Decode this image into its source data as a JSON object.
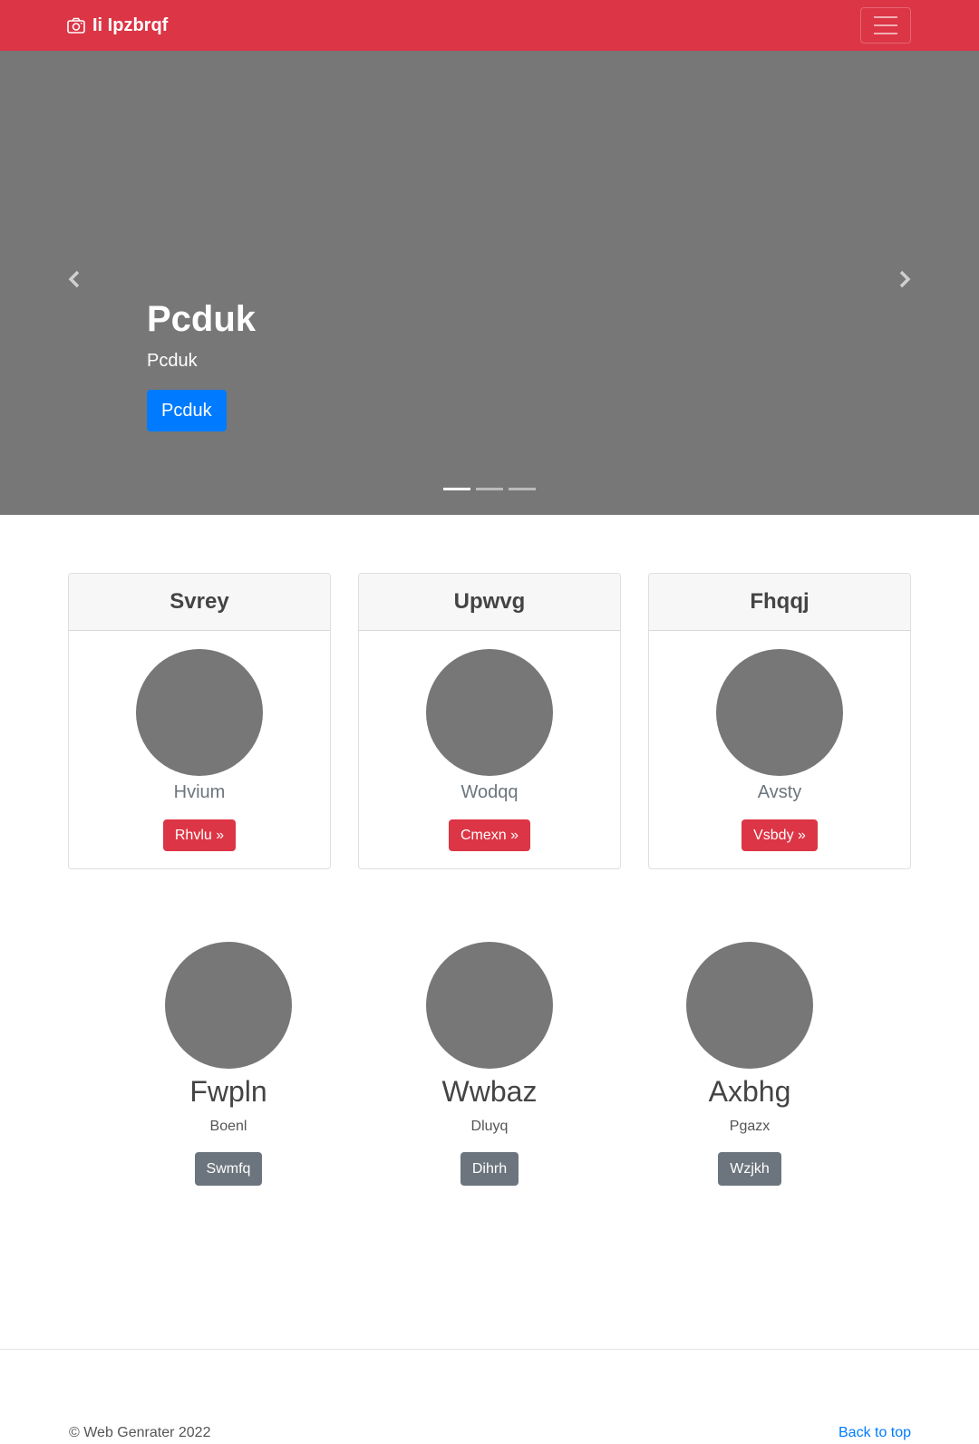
{
  "navbar": {
    "brand": "Ii Ipzbrqf",
    "brand_icon": "camera-icon",
    "toggler_icon": "menu-icon",
    "background": "#dc3545"
  },
  "carousel": {
    "title": "Pcduk",
    "text": "Pcduk",
    "button": "Pcduk",
    "slides": 3,
    "active_slide": 1,
    "prev_icon": "chevron-left-icon",
    "next_icon": "chevron-right-icon"
  },
  "cards": [
    {
      "header": "Svrey",
      "subtitle": "Hvium",
      "button": "Rhvlu »"
    },
    {
      "header": "Upwvg",
      "subtitle": "Wodqq",
      "button": "Cmexn »"
    },
    {
      "header": "Fhqqj",
      "subtitle": "Avsty",
      "button": "Vsbdy »"
    }
  ],
  "features": [
    {
      "title": "Fwpln",
      "text": "Boenl",
      "button": "Swmfq"
    },
    {
      "title": "Wwbaz",
      "text": "Dluyq",
      "button": "Dihrh"
    },
    {
      "title": "Axbhg",
      "text": "Pgazx",
      "button": "Wzjkh"
    }
  ],
  "footer": {
    "copyright": "© Web Genrater 2022",
    "back_to_top": "Back to top"
  },
  "colors": {
    "primary": "#007bff",
    "danger": "#dc3545",
    "secondary": "#6c757d",
    "placeholder": "#777777"
  }
}
